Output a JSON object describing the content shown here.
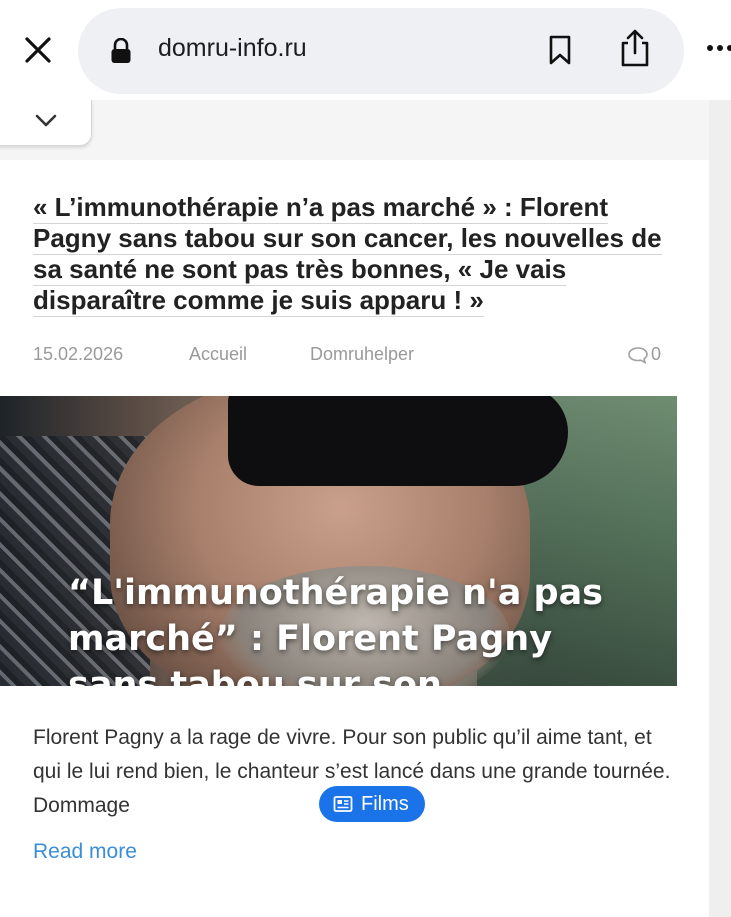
{
  "browser": {
    "url": "domru-info.ru"
  },
  "article": {
    "headline": "« L’immunothérapie n’a pas marché » : Florent Pagny sans tabou sur son cancer, les nouvelles de sa santé ne sont pas très bonnes, « Je vais disparaître comme je suis apparu ! »",
    "date": "15.02.2026",
    "category": "Accueil",
    "author": "Domruhelper",
    "comment_count": "0",
    "image_overlay_text": "“L'immunothérapie n'a pas marché” : Florent Pagny sans tabou sur son",
    "excerpt": "Florent Pagny a la rage de vivre. Pour son public qu’il aime tant, et qui le lui rend bien, le chanteur s’est lancé dans une grande tournée. Dommage",
    "read_more": "Read more"
  },
  "films_pill": {
    "label": "Films"
  },
  "colors": {
    "accent": "#1a73e8",
    "link": "#3b8ed6",
    "meta_text": "#9a9a9a"
  }
}
